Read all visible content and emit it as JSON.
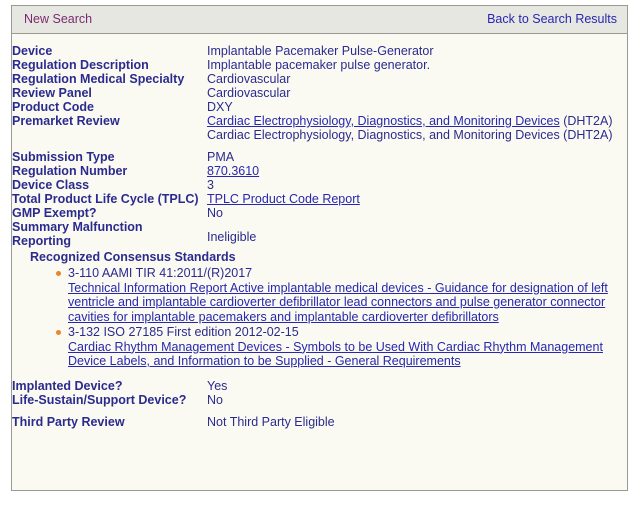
{
  "navbar": {
    "new_search": "New Search",
    "back_to_results": "Back to Search Results"
  },
  "colors": {
    "label_navy": "#2b2b8f",
    "link_blue": "#2727b0",
    "visited_purple": "#7a2a6e",
    "bullet_orange": "#e8862a",
    "navbar_bg": "#e7e7e2",
    "body_bg": "#fafaf2",
    "border": "#9a9a94"
  },
  "detail": {
    "rows": [
      {
        "label": "Device",
        "value": "Implantable Pacemaker Pulse-Generator"
      },
      {
        "label": "Regulation Description",
        "value": "Implantable pacemaker pulse generator."
      },
      {
        "label": "Regulation Medical Specialty",
        "value": "Cardiovascular"
      },
      {
        "label": "Review Panel",
        "value": "Cardiovascular"
      },
      {
        "label": "Product Code",
        "value": "DXY"
      },
      {
        "label": "Premarket Review",
        "link_value": "Cardiac Electrophysiology, Diagnostics, and Monitoring Devices",
        "link_suffix": " (DHT2A)",
        "second_line": "Cardiac Electrophysiology, Diagnostics, and Monitoring Devices (DHT2A)"
      },
      {
        "label": "Submission Type",
        "value": "PMA"
      },
      {
        "label": "Regulation Number",
        "link_value": "870.3610"
      },
      {
        "label": "Device Class",
        "value": "3"
      },
      {
        "label": "Total Product Life Cycle (TPLC)",
        "link_value": "TPLC Product Code Report"
      },
      {
        "label": "GMP Exempt?",
        "value": "No"
      },
      {
        "label": "Summary Malfunction Reporting",
        "label_line1": "Summary Malfunction",
        "label_line2": "Reporting",
        "value": "Ineligible"
      }
    ],
    "bottom_rows": [
      {
        "label": "Implanted Device?",
        "value": "Yes"
      },
      {
        "label": "Life-Sustain/Support Device?",
        "value": "No"
      },
      {
        "label": "Third Party Review",
        "value": "Not Third Party Eligible"
      }
    ]
  },
  "consensus_standards": {
    "heading": "Recognized Consensus Standards",
    "items": [
      {
        "title": "3-110 AAMI TIR 41:2011/(R)2017",
        "description": "Technical Information Report Active implantable medical devices - Guidance for designation of left ventricle and implantable cardioverter defibrillator lead connectors and pulse generator connector cavities for implantable pacemakers and implantable cardioverter defibrillators"
      },
      {
        "title": "3-132 ISO 27185 First edition 2012-02-15",
        "description": "Cardiac Rhythm Management Devices - Symbols to be Used With Cardiac Rhythm Management Device Labels, and Information to be Supplied - General Requirements"
      }
    ]
  }
}
